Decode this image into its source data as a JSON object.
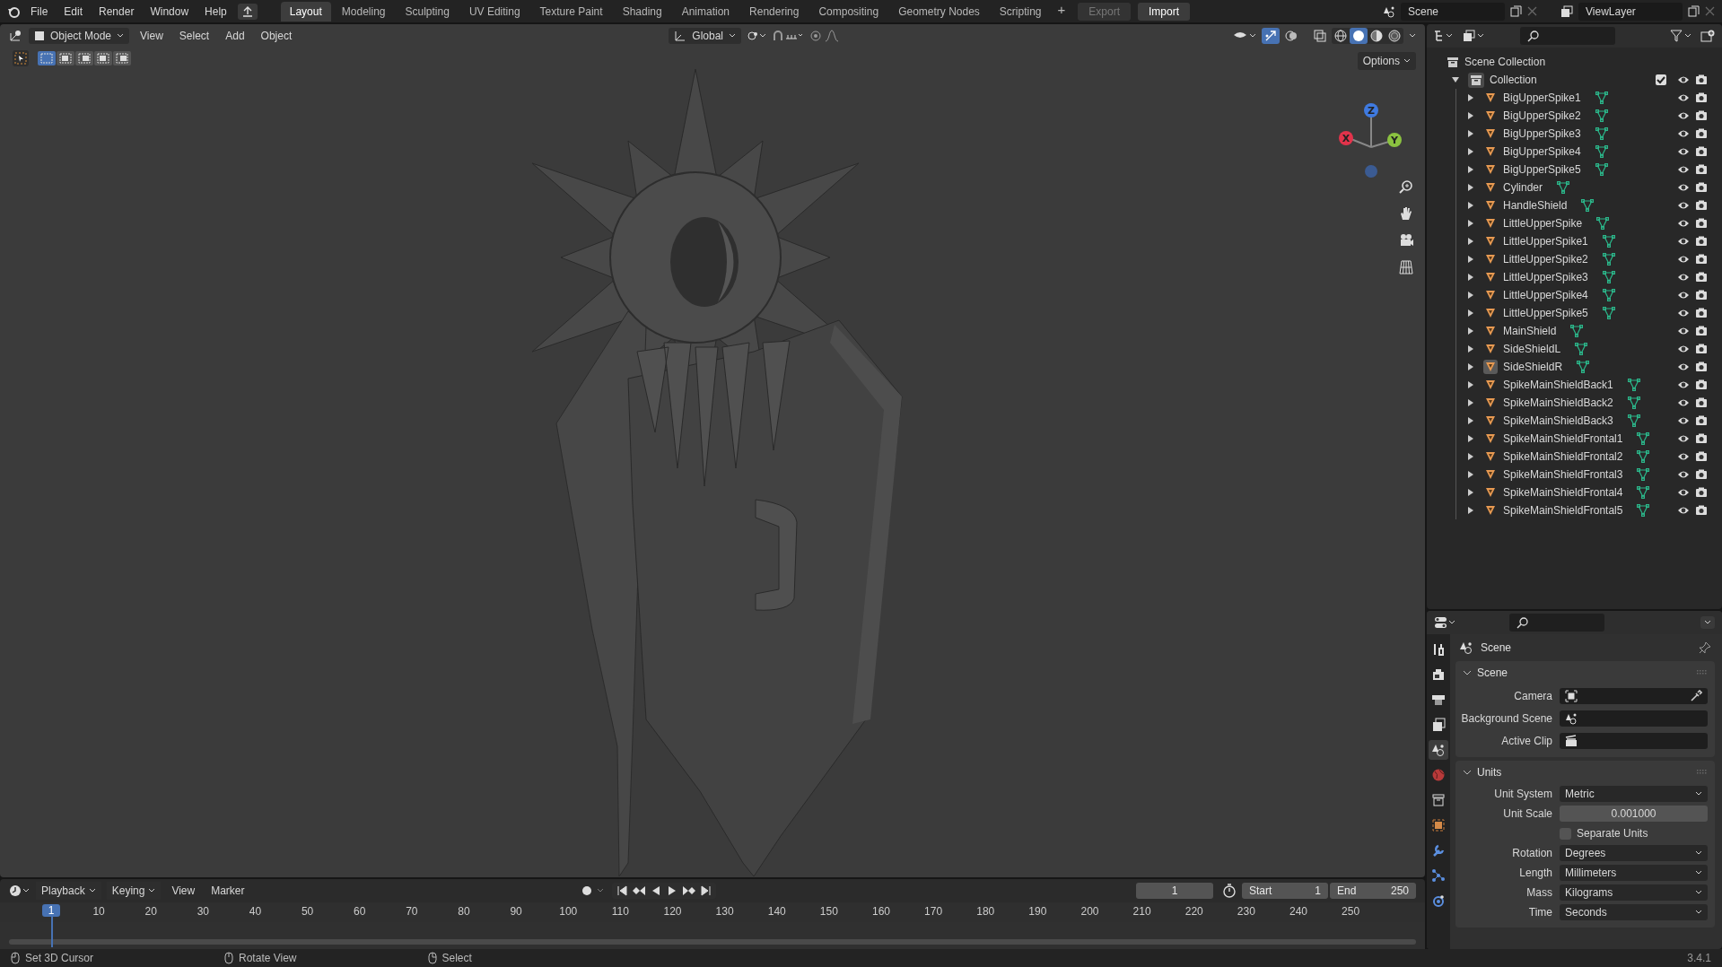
{
  "menu": [
    "File",
    "Edit",
    "Render",
    "Window",
    "Help"
  ],
  "workspaces": [
    {
      "label": "Layout",
      "selected": true
    },
    {
      "label": "Modeling",
      "selected": false
    },
    {
      "label": "Sculpting",
      "selected": false
    },
    {
      "label": "UV Editing",
      "selected": false
    },
    {
      "label": "Texture Paint",
      "selected": false
    },
    {
      "label": "Shading",
      "selected": false
    },
    {
      "label": "Animation",
      "selected": false
    },
    {
      "label": "Rendering",
      "selected": false
    },
    {
      "label": "Compositing",
      "selected": false
    },
    {
      "label": "Geometry Nodes",
      "selected": false
    },
    {
      "label": "Scripting",
      "selected": false
    }
  ],
  "add_workspace": "+",
  "export_button": {
    "label": "Export",
    "disabled": true
  },
  "import_button": {
    "label": "Import",
    "disabled": false
  },
  "scene_field": "Scene",
  "view_layer_field": "ViewLayer",
  "viewport": {
    "mode": "Object Mode",
    "menus": [
      "View",
      "Select",
      "Add",
      "Object"
    ],
    "orientation": "Global",
    "options": "Options",
    "select_modes": [
      {
        "selected": true
      },
      {
        "selected": false
      },
      {
        "selected": false
      },
      {
        "selected": false
      },
      {
        "selected": false
      }
    ],
    "gizmos_on": true,
    "shading": [
      {
        "kind": "wireframe",
        "selected": false
      },
      {
        "kind": "solid",
        "selected": true
      },
      {
        "kind": "material",
        "selected": false
      },
      {
        "kind": "rendered",
        "selected": false
      }
    ],
    "axes": [
      "X",
      "Y",
      "Z"
    ]
  },
  "outliner": {
    "root": "Scene Collection",
    "collections": [
      {
        "name": "Collection",
        "expanded": true,
        "checked": true,
        "children": [
          {
            "name": "BigUpperSpike1",
            "expanded": false,
            "active": false
          },
          {
            "name": "BigUpperSpike2",
            "expanded": false,
            "active": false
          },
          {
            "name": "BigUpperSpike3",
            "expanded": false,
            "active": false
          },
          {
            "name": "BigUpperSpike4",
            "expanded": false,
            "active": false
          },
          {
            "name": "BigUpperSpike5",
            "expanded": false,
            "active": false
          },
          {
            "name": "Cylinder",
            "expanded": false,
            "active": false
          },
          {
            "name": "HandleShield",
            "expanded": false,
            "active": false
          },
          {
            "name": "LittleUpperSpike",
            "expanded": false,
            "active": false
          },
          {
            "name": "LittleUpperSpike1",
            "expanded": false,
            "active": false
          },
          {
            "name": "LittleUpperSpike2",
            "expanded": false,
            "active": false
          },
          {
            "name": "LittleUpperSpike3",
            "expanded": false,
            "active": false
          },
          {
            "name": "LittleUpperSpike4",
            "expanded": false,
            "active": false
          },
          {
            "name": "LittleUpperSpike5",
            "expanded": false,
            "active": false
          },
          {
            "name": "MainShield",
            "expanded": false,
            "active": false
          },
          {
            "name": "SideShieldL",
            "expanded": false,
            "active": false
          },
          {
            "name": "SideShieldR",
            "expanded": false,
            "active": true
          },
          {
            "name": "SpikeMainShieldBack1",
            "expanded": false,
            "active": false
          },
          {
            "name": "SpikeMainShieldBack2",
            "expanded": false,
            "active": false
          },
          {
            "name": "SpikeMainShieldBack3",
            "expanded": false,
            "active": false
          },
          {
            "name": "SpikeMainShieldFrontal1",
            "expanded": false,
            "active": false
          },
          {
            "name": "SpikeMainShieldFrontal2",
            "expanded": false,
            "active": false
          },
          {
            "name": "SpikeMainShieldFrontal3",
            "expanded": false,
            "active": false
          },
          {
            "name": "SpikeMainShieldFrontal4",
            "expanded": false,
            "active": false
          },
          {
            "name": "SpikeMainShieldFrontal5",
            "expanded": false,
            "active": false
          }
        ]
      }
    ]
  },
  "properties": {
    "tabs": [
      {
        "kind": "tool",
        "selected": false
      },
      {
        "kind": "render",
        "selected": false
      },
      {
        "kind": "output",
        "selected": false
      },
      {
        "kind": "view_layer",
        "selected": false
      },
      {
        "kind": "scene",
        "selected": true
      },
      {
        "kind": "world",
        "selected": false
      },
      {
        "kind": "collection",
        "selected": false
      },
      {
        "kind": "object",
        "selected": false
      },
      {
        "kind": "modifiers",
        "selected": false
      },
      {
        "kind": "particles",
        "selected": false
      },
      {
        "kind": "physics",
        "selected": false
      }
    ],
    "title": "Scene",
    "panels": [
      {
        "title": "Scene",
        "expanded": true,
        "fields": [
          {
            "kind": "id",
            "label": "Camera"
          },
          {
            "kind": "id",
            "label": "Background Scene"
          },
          {
            "kind": "id",
            "label": "Active Clip"
          }
        ]
      },
      {
        "title": "Units",
        "expanded": true,
        "fields": [
          {
            "kind": "select",
            "label": "Unit System",
            "value": "Metric"
          },
          {
            "kind": "number",
            "label": "Unit Scale",
            "value": "0.001000"
          },
          {
            "kind": "checkbox",
            "label": "Separate Units",
            "checked": false
          },
          {
            "kind": "select",
            "label": "Rotation",
            "value": "Degrees"
          },
          {
            "kind": "select",
            "label": "Length",
            "value": "Millimeters"
          },
          {
            "kind": "select",
            "label": "Mass",
            "value": "Kilograms"
          },
          {
            "kind": "select",
            "label": "Time",
            "value": "Seconds"
          }
        ]
      }
    ]
  },
  "timeline": {
    "menus": [
      "Playback",
      "Keying",
      "View",
      "Marker"
    ],
    "current_frame": "1",
    "playhead_frame": "1",
    "start_label": "Start",
    "start": "1",
    "end_label": "End",
    "end": "250",
    "ticks": [
      "10",
      "20",
      "30",
      "40",
      "50",
      "60",
      "70",
      "80",
      "90",
      "100",
      "110",
      "120",
      "130",
      "140",
      "150",
      "160",
      "170",
      "180",
      "190",
      "200",
      "210",
      "220",
      "230",
      "240",
      "250"
    ]
  },
  "status_bar": {
    "hints": [
      "Set 3D Cursor",
      "Rotate View",
      "Select"
    ],
    "version": "3.4.1"
  }
}
